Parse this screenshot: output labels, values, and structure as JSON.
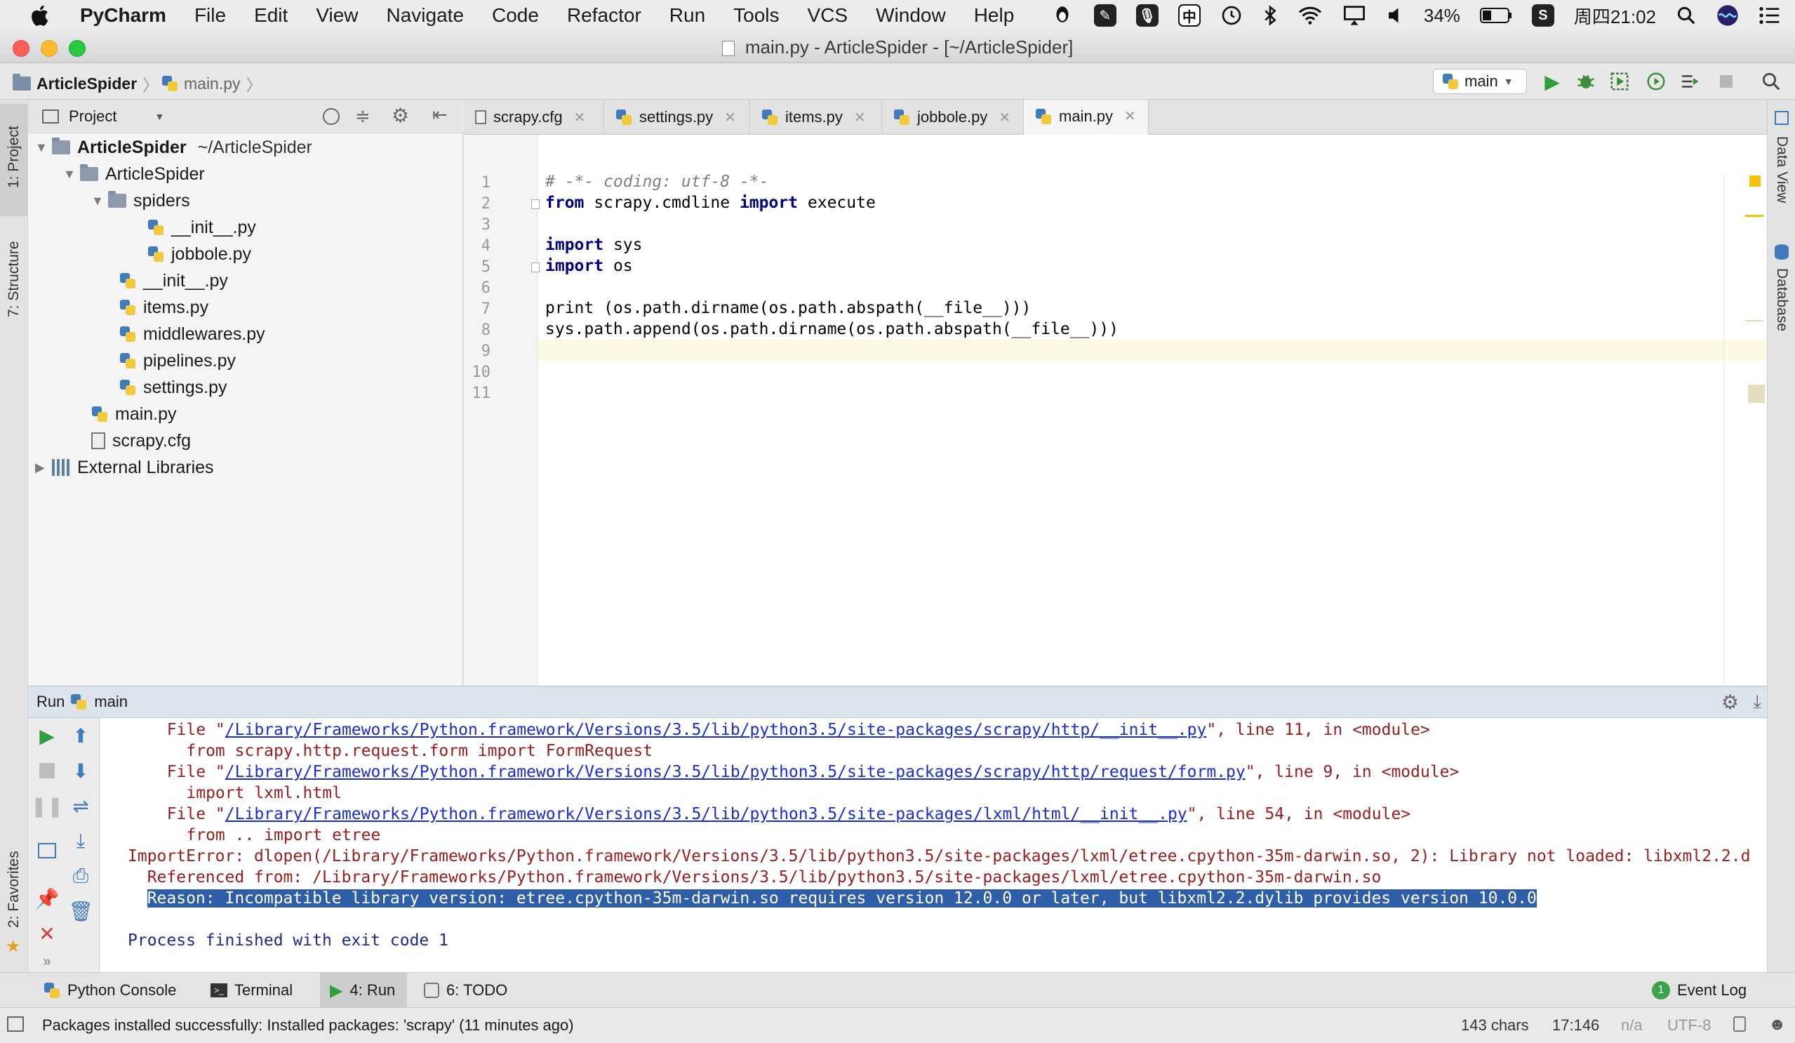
{
  "menubar": {
    "app_name": "PyCharm",
    "items": [
      "File",
      "Edit",
      "View",
      "Navigate",
      "Code",
      "Refactor",
      "Run",
      "Tools",
      "VCS",
      "Window",
      "Help"
    ],
    "battery": "34%",
    "clock": "周四21:02",
    "ime": "中"
  },
  "window": {
    "title": "main.py - ArticleSpider - [~/ArticleSpider]"
  },
  "navbar": {
    "crumbs": [
      "ArticleSpider",
      "main.py"
    ],
    "run_config": "main"
  },
  "project": {
    "header_label": "Project",
    "tree": [
      {
        "label": "ArticleSpider",
        "suffix": "~/ArticleSpider",
        "depth": 0,
        "kind": "folder",
        "expanded": true,
        "bold": true
      },
      {
        "label": "ArticleSpider",
        "depth": 1,
        "kind": "folder",
        "expanded": true
      },
      {
        "label": "spiders",
        "depth": 2,
        "kind": "folder",
        "expanded": true
      },
      {
        "label": "__init__.py",
        "depth": 3,
        "kind": "py"
      },
      {
        "label": "jobbole.py",
        "depth": 3,
        "kind": "py"
      },
      {
        "label": "__init__.py",
        "depth": 2,
        "kind": "py"
      },
      {
        "label": "items.py",
        "depth": 2,
        "kind": "py"
      },
      {
        "label": "middlewares.py",
        "depth": 2,
        "kind": "py"
      },
      {
        "label": "pipelines.py",
        "depth": 2,
        "kind": "py"
      },
      {
        "label": "settings.py",
        "depth": 2,
        "kind": "py"
      },
      {
        "label": "main.py",
        "depth": 1,
        "kind": "py"
      },
      {
        "label": "scrapy.cfg",
        "depth": 1,
        "kind": "cfg"
      },
      {
        "label": "External Libraries",
        "depth": 0,
        "kind": "lib",
        "expanded": false
      }
    ]
  },
  "tabs": [
    {
      "label": "scrapy.cfg",
      "active": false
    },
    {
      "label": "settings.py",
      "active": false
    },
    {
      "label": "items.py",
      "active": false
    },
    {
      "label": "jobbole.py",
      "active": false
    },
    {
      "label": "main.py",
      "active": true
    }
  ],
  "editor": {
    "lines": [
      "# -*- coding: utf-8 -*-",
      "from scrapy.cmdline import execute",
      "",
      "import sys",
      "import os",
      "",
      "print (os.path.dirname(os.path.abspath(__file__)))",
      "sys.path.append(os.path.dirname(os.path.abspath(__file__)))",
      "",
      "",
      ""
    ],
    "current_line": 9
  },
  "run_panel": {
    "label": "Run",
    "config": "main",
    "console": [
      {
        "pre": "  File \"",
        "link": "/Library/Frameworks/Python.framework/Versions/3.5/lib/python3.5/site-packages/scrapy/http/__init__.py",
        "post": "\", line 11, in <module>"
      },
      {
        "text": "    from scrapy.http.request.form import FormRequest"
      },
      {
        "pre": "  File \"",
        "link": "/Library/Frameworks/Python.framework/Versions/3.5/lib/python3.5/site-packages/scrapy/http/request/form.py",
        "post": "\", line 9, in <module>"
      },
      {
        "text": "    import lxml.html"
      },
      {
        "pre": "  File \"",
        "link": "/Library/Frameworks/Python.framework/Versions/3.5/lib/python3.5/site-packages/lxml/html/__init__.py",
        "post": "\", line 54, in <module>"
      },
      {
        "text": "    from .. import etree"
      },
      {
        "text": "ImportError: dlopen(/Library/Frameworks/Python.framework/Versions/3.5/lib/python3.5/site-packages/lxml/etree.cpython-35m-darwin.so, 2): Library not loaded: libxml2.2.d"
      },
      {
        "text": "  Referenced from: /Library/Frameworks/Python.framework/Versions/3.5/lib/python3.5/site-packages/lxml/etree.cpython-35m-darwin.so"
      },
      {
        "text": "  Reason: Incompatible library version: etree.cpython-35m-darwin.so requires version 12.0.0 or later, but libxml2.2.dylib provides version 10.0.0",
        "selected": true
      },
      {
        "text": ""
      },
      {
        "text": "Process finished with exit code 1",
        "blue": true
      }
    ]
  },
  "bottom_tabs": [
    {
      "label": "Python Console",
      "active": false
    },
    {
      "label": "Terminal",
      "active": false
    },
    {
      "label": "4: Run",
      "active": true
    },
    {
      "label": "6: TODO",
      "active": false
    }
  ],
  "event_log": {
    "label": "Event Log",
    "count": "1"
  },
  "status": {
    "message": "Packages installed successfully: Installed packages: 'scrapy' (11 minutes ago)",
    "chars": "143 chars",
    "position": "17:146",
    "line_sep": "n/a",
    "encoding": "UTF-8"
  },
  "stripes": {
    "left": [
      "1: Project",
      "7: Structure",
      "2: Favorites"
    ],
    "right": [
      "Data View",
      "Database"
    ]
  }
}
